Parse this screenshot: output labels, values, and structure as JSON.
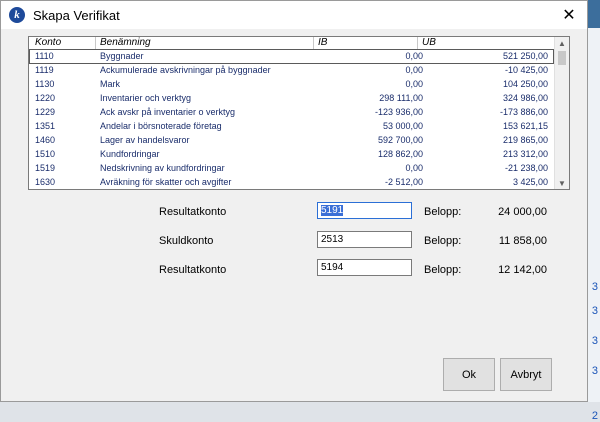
{
  "window": {
    "title": "Skapa Verifikat",
    "close_glyph": "✕"
  },
  "accounts_table": {
    "columns": [
      "Konto",
      "Benämning",
      "IB",
      "UB"
    ],
    "rows": [
      {
        "konto": "1110",
        "benamning": "Byggnader",
        "ib": "0,00",
        "ub": "521 250,00"
      },
      {
        "konto": "1119",
        "benamning": "Ackumulerade avskrivningar på byggnader",
        "ib": "0,00",
        "ub": "-10 425,00"
      },
      {
        "konto": "1130",
        "benamning": "Mark",
        "ib": "0,00",
        "ub": "104 250,00"
      },
      {
        "konto": "1220",
        "benamning": "Inventarier och verktyg",
        "ib": "298 111,00",
        "ub": "324 986,00"
      },
      {
        "konto": "1229",
        "benamning": "Ack avskr på inventarier o verktyg",
        "ib": "-123 936,00",
        "ub": "-173 886,00"
      },
      {
        "konto": "1351",
        "benamning": "Andelar i börsnoterade företag",
        "ib": "53 000,00",
        "ub": "153 621,15"
      },
      {
        "konto": "1460",
        "benamning": "Lager av handelsvaror",
        "ib": "592 700,00",
        "ub": "219 865,00"
      },
      {
        "konto": "1510",
        "benamning": "Kundfordringar",
        "ib": "128 862,00",
        "ub": "213 312,00"
      },
      {
        "konto": "1519",
        "benamning": "Nedskrivning av kundfordringar",
        "ib": "0,00",
        "ub": "-21 238,00"
      },
      {
        "konto": "1630",
        "benamning": "Avräkning för skatter och avgifter",
        "ib": "-2 512,00",
        "ub": "3 425,00"
      }
    ]
  },
  "form": {
    "rows": [
      {
        "label": "Resultatkonto",
        "value": "5191",
        "belopp_label": "Belopp:",
        "belopp": "24 000,00"
      },
      {
        "label": "Skuldkonto",
        "value": "2513",
        "belopp_label": "Belopp:",
        "belopp": "11 858,00"
      },
      {
        "label": "Resultatkonto",
        "value": "5194",
        "belopp_label": "Belopp:",
        "belopp": "12 142,00"
      }
    ]
  },
  "buttons": {
    "ok": "Ok",
    "cancel": "Avbryt"
  },
  "background": {
    "right_numbers": [
      "3",
      "3",
      "3",
      "3",
      "2"
    ]
  }
}
